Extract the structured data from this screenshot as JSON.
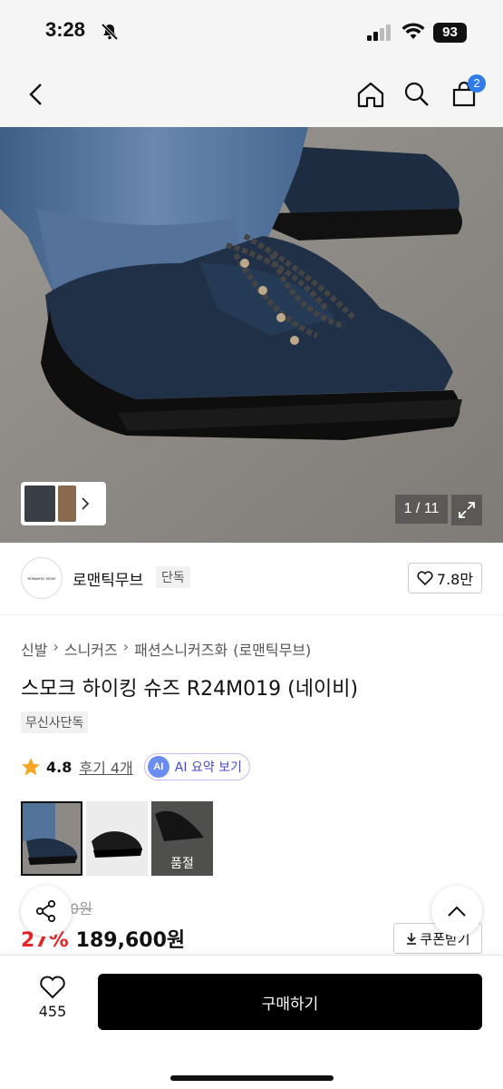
{
  "status_bar": {
    "time": "3:28",
    "battery": "93"
  },
  "nav": {
    "cart_count": "2"
  },
  "gallery": {
    "counter": "1 / 11"
  },
  "brand": {
    "name": "로맨틱무브",
    "tag": "단독",
    "likes": "7.8만",
    "logo_text": "ROMANTIC MOVE"
  },
  "breadcrumb": [
    "신발",
    "스니커즈",
    "패션스니커즈화",
    "(로맨틱무브)"
  ],
  "product": {
    "title": "스모크 하이킹 슈즈 R24M019 (네이비)",
    "badge": "무신사단독"
  },
  "rating": {
    "score": "4.8",
    "reviews": "후기 4개",
    "ai_circle": "AI",
    "ai_label": "AI 요약 보기"
  },
  "options": {
    "soldout_label": "품절"
  },
  "price": {
    "original": "0원",
    "discount": "27%",
    "final": "189,600원",
    "coupon": "쿠폰받기"
  },
  "bottom": {
    "wish_count": "455",
    "buy_label": "구매하기"
  },
  "colors": {
    "accent_blue": "#2f7ce8",
    "discount_red": "#e52528",
    "ai_purple": "#4a4ad0"
  }
}
